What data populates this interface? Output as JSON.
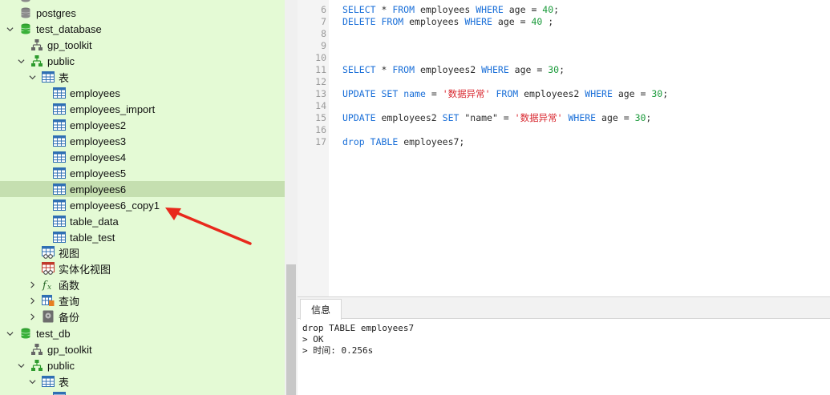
{
  "tree": {
    "items": [
      {
        "label": "postgres",
        "icon": "database-gray-icon"
      },
      {
        "label": "test_database",
        "icon": "database-icon"
      },
      {
        "label": "gp_toolkit",
        "icon": "schema-icon"
      },
      {
        "label": "public",
        "icon": "schema-icon"
      },
      {
        "label": "表",
        "icon": "tables-folder-icon"
      },
      {
        "label": "employees",
        "icon": "table-icon"
      },
      {
        "label": "employees_import",
        "icon": "table-icon"
      },
      {
        "label": "employees2",
        "icon": "table-icon"
      },
      {
        "label": "employees3",
        "icon": "table-icon"
      },
      {
        "label": "employees4",
        "icon": "table-icon"
      },
      {
        "label": "employees5",
        "icon": "table-icon"
      },
      {
        "label": "employees6",
        "icon": "table-icon"
      },
      {
        "label": "employees6_copy1",
        "icon": "table-icon"
      },
      {
        "label": "table_data",
        "icon": "table-icon"
      },
      {
        "label": "table_test",
        "icon": "table-icon"
      },
      {
        "label": "视图",
        "icon": "view-icon"
      },
      {
        "label": "实体化视图",
        "icon": "materialized-view-icon"
      },
      {
        "label": "函数",
        "icon": "function-icon"
      },
      {
        "label": "查询",
        "icon": "query-icon"
      },
      {
        "label": "备份",
        "icon": "backup-icon"
      },
      {
        "label": "test_db",
        "icon": "database-icon"
      },
      {
        "label": "gp_toolkit",
        "icon": "schema-icon"
      },
      {
        "label": "public",
        "icon": "schema-icon"
      },
      {
        "label": "表",
        "icon": "tables-folder-icon"
      }
    ],
    "selected": "employees6"
  },
  "editor": {
    "lines": [
      {
        "n": "6",
        "tokens": []
      },
      {
        "n": "7",
        "tokens": [
          [
            "kw",
            "DELETE"
          ],
          [
            "plain",
            " "
          ],
          [
            "kw",
            "FROM"
          ],
          [
            "plain",
            " employees "
          ],
          [
            "kw",
            "WHERE"
          ],
          [
            "plain",
            " age = "
          ],
          [
            "num",
            "40"
          ],
          [
            "plain",
            " ;"
          ]
        ]
      },
      {
        "n": "8",
        "tokens": []
      },
      {
        "n": "9",
        "tokens": []
      },
      {
        "n": "10",
        "tokens": []
      },
      {
        "n": "11",
        "tokens": [
          [
            "kw",
            "SELECT"
          ],
          [
            "plain",
            " * "
          ],
          [
            "kw",
            "FROM"
          ],
          [
            "plain",
            " employees2 "
          ],
          [
            "kw",
            "WHERE"
          ],
          [
            "plain",
            " age = "
          ],
          [
            "num",
            "30"
          ],
          [
            "plain",
            ";"
          ]
        ]
      },
      {
        "n": "12",
        "tokens": []
      },
      {
        "n": "13",
        "tokens": [
          [
            "kw",
            "UPDATE"
          ],
          [
            "plain",
            " "
          ],
          [
            "kw",
            "SET"
          ],
          [
            "plain",
            " "
          ],
          [
            "kw",
            "name"
          ],
          [
            "plain",
            " = "
          ],
          [
            "str",
            "'数据异常'"
          ],
          [
            "plain",
            " "
          ],
          [
            "kw",
            "FROM"
          ],
          [
            "plain",
            " employees2 "
          ],
          [
            "kw",
            "WHERE"
          ],
          [
            "plain",
            " age = "
          ],
          [
            "num",
            "30"
          ],
          [
            "plain",
            ";"
          ]
        ]
      },
      {
        "n": "14",
        "tokens": []
      },
      {
        "n": "15",
        "tokens": [
          [
            "kw",
            "UPDATE"
          ],
          [
            "plain",
            " employees2 "
          ],
          [
            "kw",
            "SET"
          ],
          [
            "plain",
            " \"name\" = "
          ],
          [
            "str",
            "'数据异常'"
          ],
          [
            "plain",
            " "
          ],
          [
            "kw",
            "WHERE"
          ],
          [
            "plain",
            " age = "
          ],
          [
            "num",
            "30"
          ],
          [
            "plain",
            ";"
          ]
        ]
      },
      {
        "n": "16",
        "tokens": []
      },
      {
        "n": "17",
        "tokens": [
          [
            "kw",
            "drop"
          ],
          [
            "plain",
            " "
          ],
          [
            "kw",
            "TABLE"
          ],
          [
            "plain",
            " employees7;"
          ]
        ]
      }
    ]
  },
  "info": {
    "tab_label": "信息",
    "lines": [
      "drop TABLE employees7",
      "> OK",
      "> 时间: 0.256s"
    ]
  },
  "colors": {
    "tree_bg": "#e4fad5",
    "tree_selected": "#c5dfb0",
    "keyword": "#1a6fd8",
    "number": "#1a9a3a",
    "string": "#d8262e",
    "annotation_arrow": "#e8291c"
  }
}
